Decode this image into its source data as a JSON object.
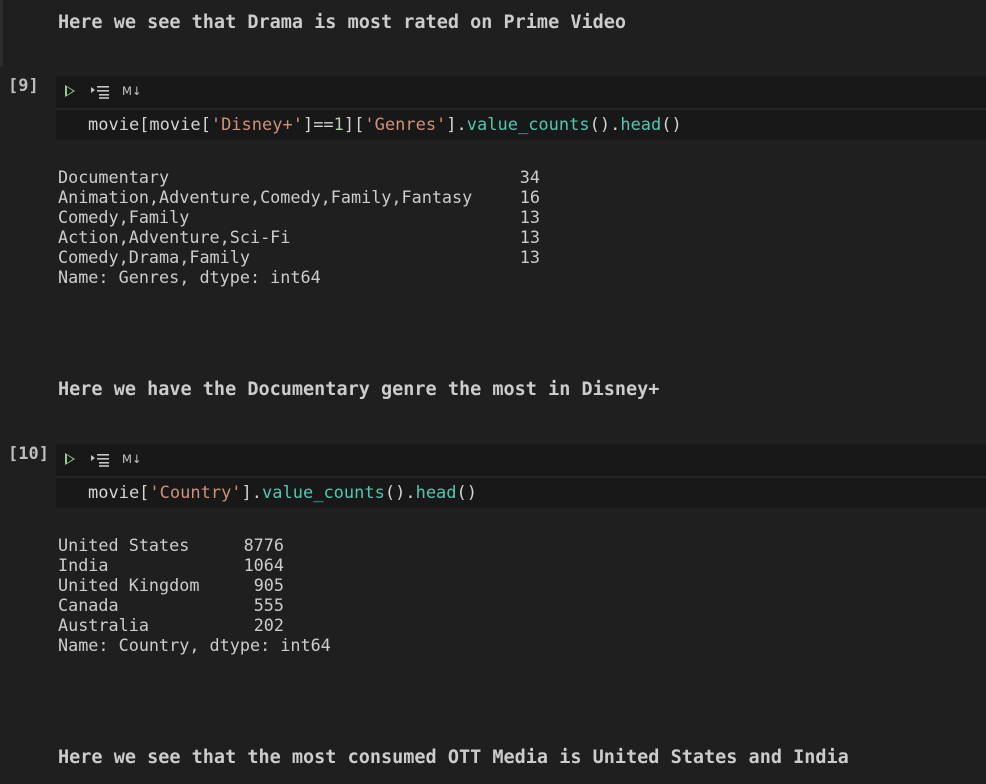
{
  "markdown": {
    "note_prime": "Here we see that Drama is most rated on Prime Video",
    "note_disney": "Here we have the Documentary genre the most in Disney+",
    "note_country": "Here we see that the most consumed OTT Media is United States and India"
  },
  "toolbar": {
    "run_icon": "run-cell-icon",
    "run_below_icon": "run-below-icon",
    "markdown_label": "M↓"
  },
  "cells": [
    {
      "execution_count": "[9]",
      "code_tokens": [
        {
          "t": "movie[movie[",
          "c": "id"
        },
        {
          "t": "'Disney+'",
          "c": "str"
        },
        {
          "t": "]==",
          "c": "op"
        },
        {
          "t": "1",
          "c": "num"
        },
        {
          "t": "][",
          "c": "op"
        },
        {
          "t": "'Genres'",
          "c": "str"
        },
        {
          "t": "].",
          "c": "op"
        },
        {
          "t": "value_counts",
          "c": "mth"
        },
        {
          "t": "().",
          "c": "op"
        },
        {
          "t": "head",
          "c": "mth"
        },
        {
          "t": "()",
          "c": "op"
        }
      ],
      "output": {
        "rows": [
          {
            "key": "Documentary",
            "value": "34"
          },
          {
            "key": "Animation,Adventure,Comedy,Family,Fantasy",
            "value": "16"
          },
          {
            "key": "Comedy,Family",
            "value": "13"
          },
          {
            "key": "Action,Adventure,Sci-Fi",
            "value": "13"
          },
          {
            "key": "Comedy,Drama,Family",
            "value": "13"
          }
        ],
        "footer": "Name: Genres, dtype: int64"
      }
    },
    {
      "execution_count": "[10]",
      "code_tokens": [
        {
          "t": "movie[",
          "c": "id"
        },
        {
          "t": "'Country'",
          "c": "str"
        },
        {
          "t": "].",
          "c": "op"
        },
        {
          "t": "value_counts",
          "c": "mth"
        },
        {
          "t": "().",
          "c": "op"
        },
        {
          "t": "head",
          "c": "mth"
        },
        {
          "t": "()",
          "c": "op"
        }
      ],
      "output": {
        "rows": [
          {
            "key": "United States",
            "value": "8776"
          },
          {
            "key": "India",
            "value": "1064"
          },
          {
            "key": "United Kingdom",
            "value": "905"
          },
          {
            "key": "Canada",
            "value": "555"
          },
          {
            "key": "Australia",
            "value": "202"
          }
        ],
        "footer": "Name: Country, dtype: int64"
      }
    }
  ]
}
